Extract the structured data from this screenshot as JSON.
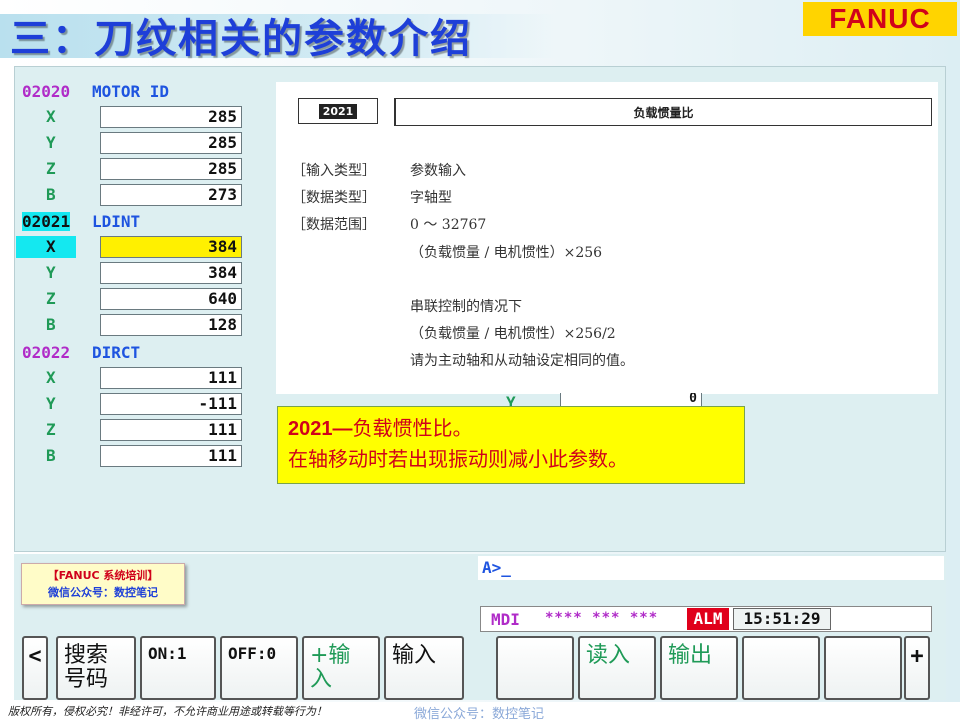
{
  "title": "三：刀纹相关的参数介绍",
  "logo": "FANUC",
  "params": [
    {
      "number": "02020",
      "name": "MOTOR ID",
      "rows": [
        {
          "axis": "X",
          "value": "285"
        },
        {
          "axis": "Y",
          "value": "285"
        },
        {
          "axis": "Z",
          "value": "285"
        },
        {
          "axis": "B",
          "value": "273"
        }
      ]
    },
    {
      "number": "02021",
      "name": "LDINT",
      "rows": [
        {
          "axis": "X",
          "value": "384"
        },
        {
          "axis": "Y",
          "value": "384"
        },
        {
          "axis": "Z",
          "value": "640"
        },
        {
          "axis": "B",
          "value": "128"
        }
      ]
    },
    {
      "number": "02022",
      "name": "DIRCT",
      "rows": [
        {
          "axis": "X",
          "value": "111"
        },
        {
          "axis": "Y",
          "value": "-111"
        },
        {
          "axis": "Z",
          "value": "111"
        },
        {
          "axis": "B",
          "value": "111"
        }
      ]
    }
  ],
  "selected": {
    "param": 1,
    "row": 0
  },
  "doc": {
    "number": "2021",
    "title": "负载惯量比",
    "lines": [
      {
        "label": "［输入类型］",
        "text": "参数输入"
      },
      {
        "label": "［数据类型］",
        "text": "字轴型"
      },
      {
        "label": "［数据范围］",
        "text": "0 ～ 32767"
      }
    ],
    "formula1": "（负载惯量 / 电机惯性）×256",
    "tandem_title": "串联控制的情况下",
    "formula2": "（负载惯量 / 电机惯性）×256/2",
    "tandem_note": "请为主动轴和从动轴设定相同的值。"
  },
  "hidden_row": {
    "axis": "Y",
    "value": "0"
  },
  "note": {
    "num": "2021—",
    "line1": "负载惯性比。",
    "line2": "在轴移动时若出现振动则减小此参数。"
  },
  "badge": {
    "line1": "【FANUC 系统培训】",
    "line2": "微信公众号：数控笔记"
  },
  "command_line": "A>_",
  "status": {
    "mode": "MDI",
    "stars": "**** *** ***",
    "alarm": "ALM",
    "time": "15:51:29"
  },
  "softkeys": [
    {
      "label": "<",
      "kind": "arrow"
    },
    {
      "label": "搜索号码",
      "kind": "cjk"
    },
    {
      "label": "ON:1",
      "kind": "mono"
    },
    {
      "label": "OFF:0",
      "kind": "mono"
    },
    {
      "label": "+输入",
      "kind": "cjk-green"
    },
    {
      "label": "输入",
      "kind": "cjk"
    },
    {
      "label": "",
      "kind": "blank"
    },
    {
      "label": "读入",
      "kind": "cjk-green"
    },
    {
      "label": "输出",
      "kind": "cjk-green"
    },
    {
      "label": "",
      "kind": "blank"
    },
    {
      "label": "",
      "kind": "blank"
    },
    {
      "label": "+",
      "kind": "arrow"
    }
  ],
  "footer": {
    "copyright": "版权所有，侵权必究！非经许可，不允许商业用途或转载等行为！",
    "wechat": "微信公众号：数控笔记"
  }
}
